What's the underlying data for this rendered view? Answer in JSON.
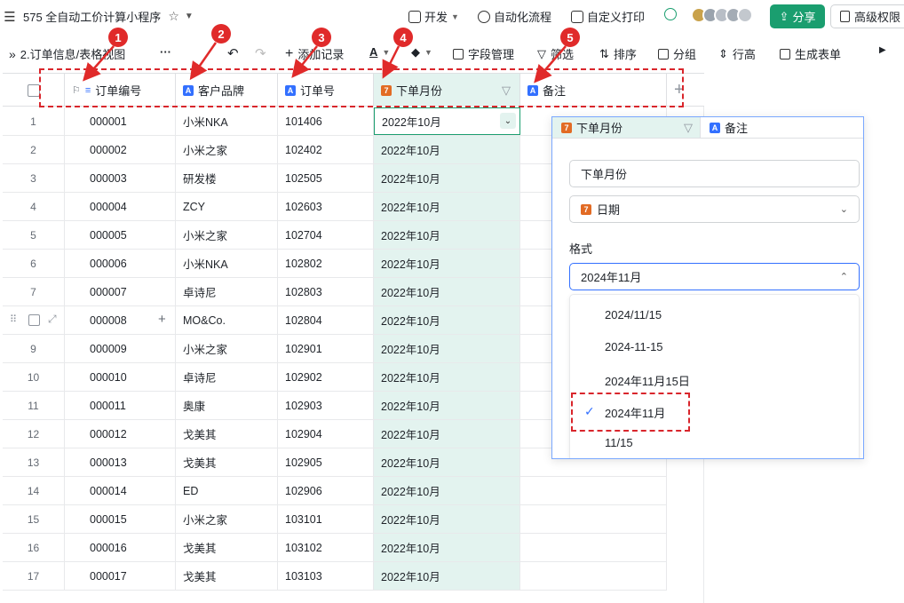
{
  "topbar": {
    "title": "575 全自动工价计算小程序",
    "dev_label": "开发",
    "automation_label": "自动化流程",
    "print_label": "自定义打印",
    "share_label": "分享",
    "permission_label": "高级权限"
  },
  "toolbar": {
    "view_name": "2.订单信息/表格视图",
    "add_record": "添加记录",
    "field_manage": "字段管理",
    "filter": "筛选",
    "sort": "排序",
    "group": "分组",
    "row_height": "行高",
    "form": "生成表单"
  },
  "columns": [
    "订单编号",
    "客户品牌",
    "订单号",
    "下单月份",
    "备注"
  ],
  "rows": [
    {
      "idx": "1",
      "no": "000001",
      "brand": "小米NKA",
      "order": "101406",
      "month": "2022年10月"
    },
    {
      "idx": "2",
      "no": "000002",
      "brand": "小米之家",
      "order": "102402",
      "month": "2022年10月"
    },
    {
      "idx": "3",
      "no": "000003",
      "brand": "研发楼",
      "order": "102505",
      "month": "2022年10月"
    },
    {
      "idx": "4",
      "no": "000004",
      "brand": "ZCY",
      "order": "102603",
      "month": "2022年10月"
    },
    {
      "idx": "5",
      "no": "000005",
      "brand": "小米之家",
      "order": "102704",
      "month": "2022年10月"
    },
    {
      "idx": "6",
      "no": "000006",
      "brand": "小米NKA",
      "order": "102802",
      "month": "2022年10月"
    },
    {
      "idx": "7",
      "no": "000007",
      "brand": "卓诗尼",
      "order": "102803",
      "month": "2022年10月"
    },
    {
      "idx": "",
      "no": "000008",
      "brand": "MO&Co.",
      "order": "102804",
      "month": "2022年10月"
    },
    {
      "idx": "9",
      "no": "000009",
      "brand": "小米之家",
      "order": "102901",
      "month": "2022年10月"
    },
    {
      "idx": "10",
      "no": "000010",
      "brand": "卓诗尼",
      "order": "102902",
      "month": "2022年10月"
    },
    {
      "idx": "11",
      "no": "000011",
      "brand": "奥康",
      "order": "102903",
      "month": "2022年10月"
    },
    {
      "idx": "12",
      "no": "000012",
      "brand": "戈美其",
      "order": "102904",
      "month": "2022年10月"
    },
    {
      "idx": "13",
      "no": "000013",
      "brand": "戈美其",
      "order": "102905",
      "month": "2022年10月"
    },
    {
      "idx": "14",
      "no": "000014",
      "brand": "ED",
      "order": "102906",
      "month": "2022年10月"
    },
    {
      "idx": "15",
      "no": "000015",
      "brand": "小米之家",
      "order": "103101",
      "month": "2022年10月"
    },
    {
      "idx": "16",
      "no": "000016",
      "brand": "戈美其",
      "order": "103102",
      "month": "2022年10月"
    },
    {
      "idx": "17",
      "no": "000017",
      "brand": "戈美其",
      "order": "103103",
      "month": "2022年10月"
    }
  ],
  "popup": {
    "header_month": "下单月份",
    "header_note": "备注",
    "field_name": "下单月份",
    "field_type": "日期",
    "format_label": "格式",
    "format_value": "2024年11月",
    "options": [
      "2024/11/15",
      "2024-11-15",
      "2024年11月15日",
      "2024年11月",
      "11/15"
    ],
    "check": "✓"
  },
  "annotations": [
    "1",
    "2",
    "3",
    "4",
    "5"
  ],
  "colors": {
    "accent": "#1a9e6f",
    "annotation": "#d9262c",
    "date_col_bg": "#e3f3ef"
  }
}
